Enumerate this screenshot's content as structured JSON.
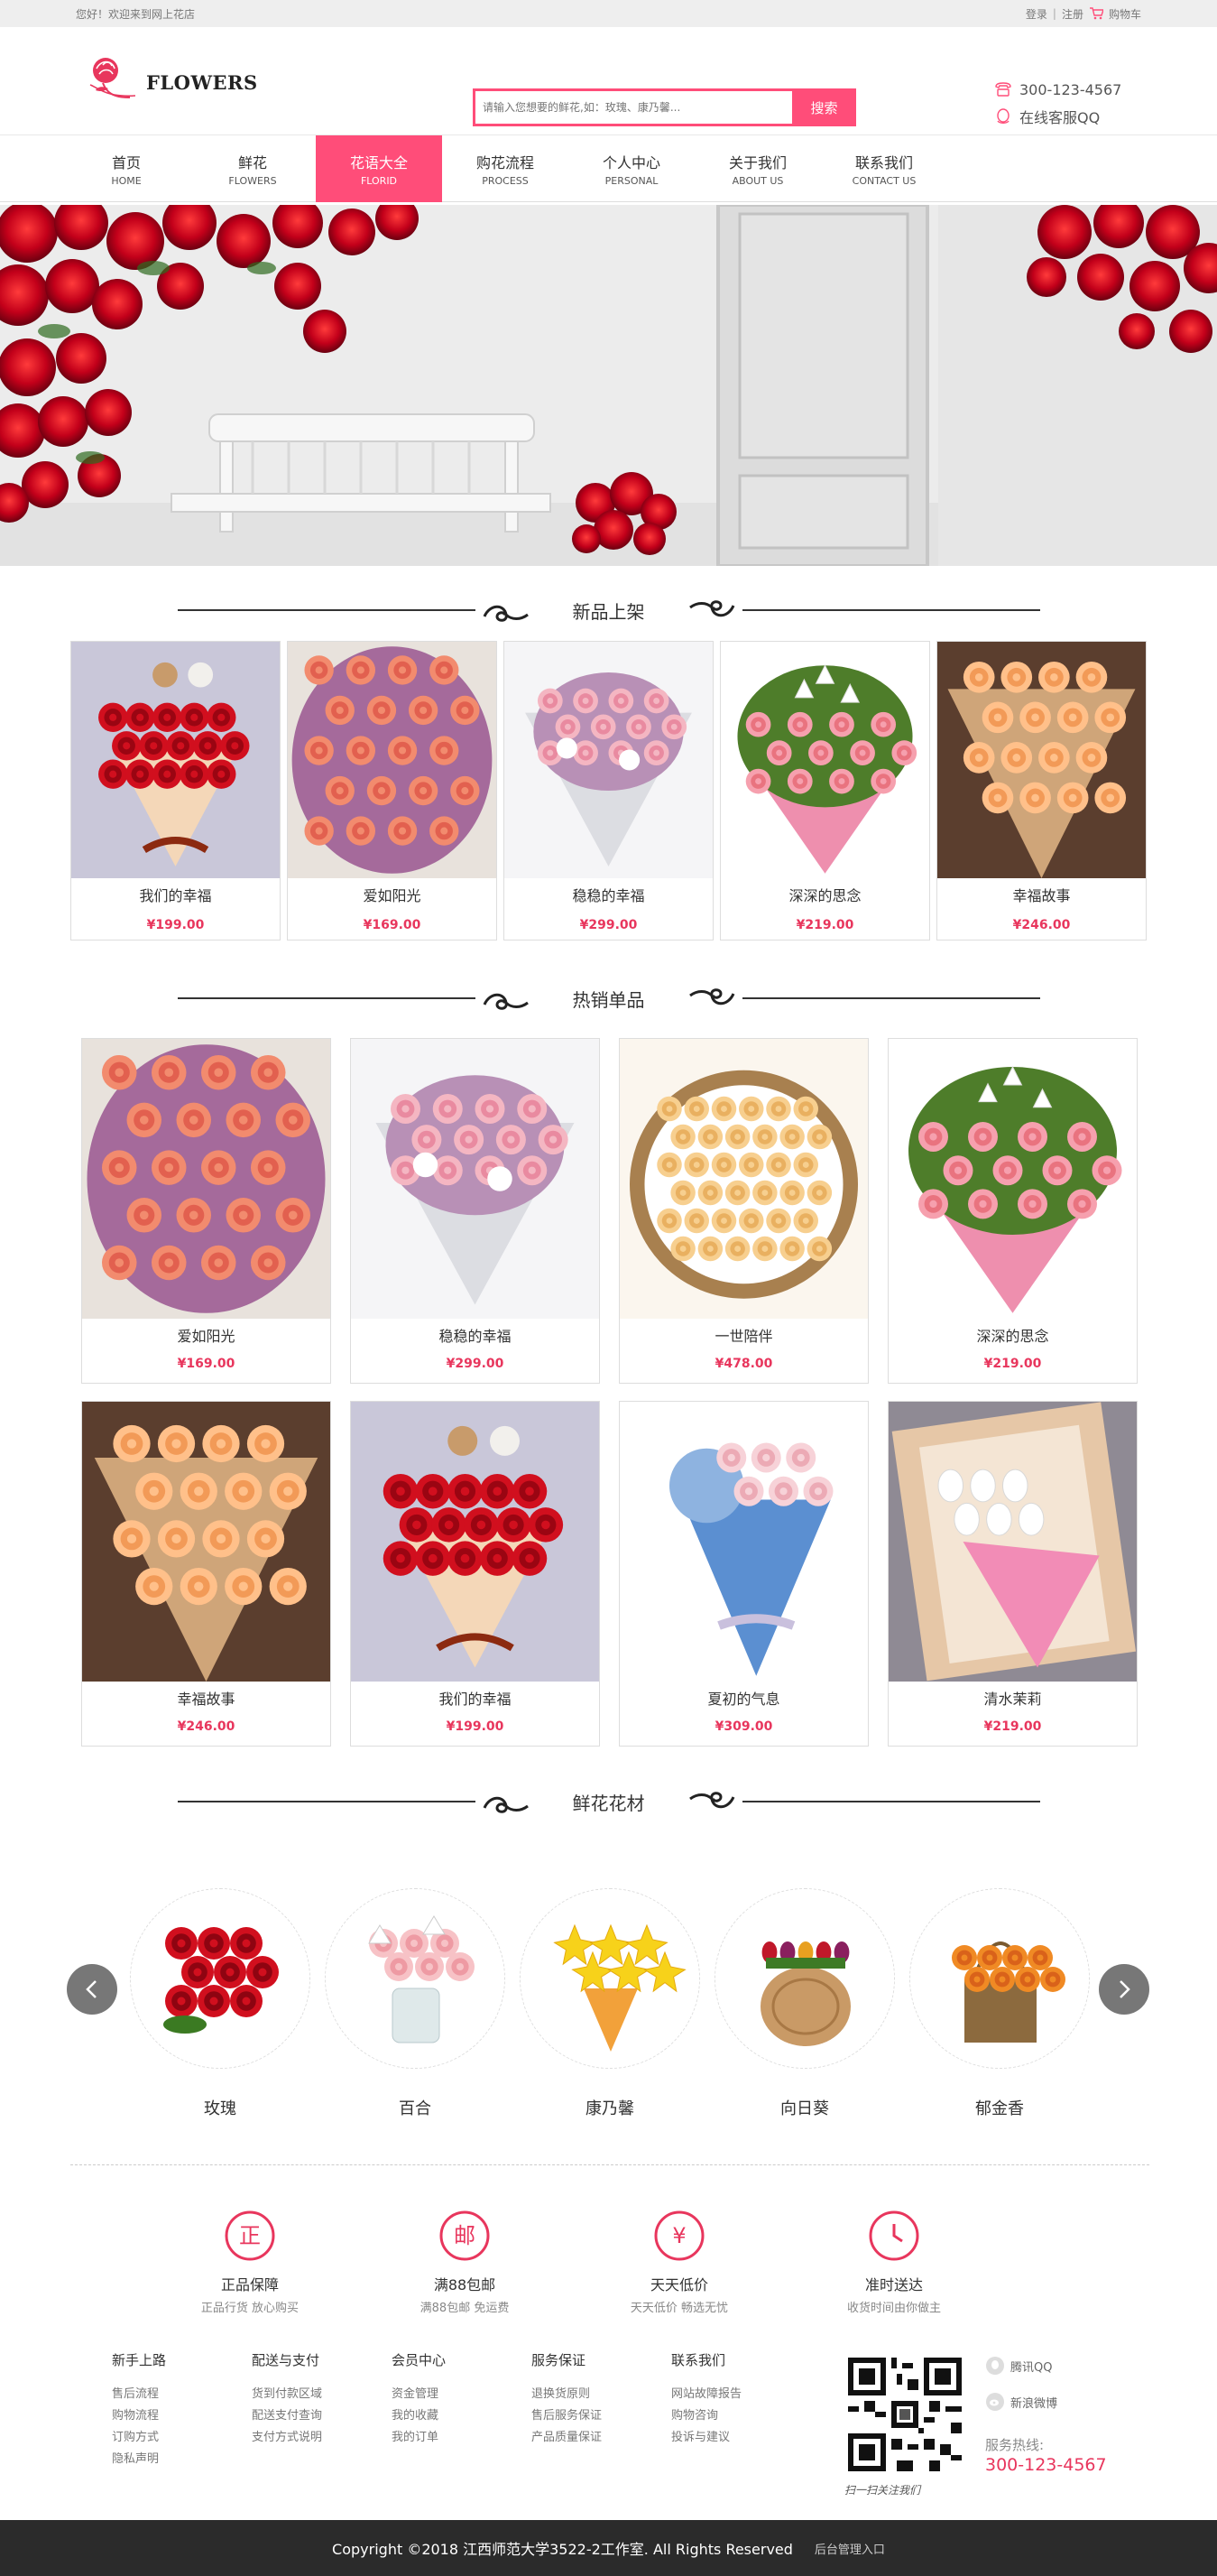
{
  "topbar": {
    "welcome": "您好！欢迎来到网上花店",
    "login": "登录",
    "sep": "|",
    "register": "注册",
    "cart": "购物车"
  },
  "header": {
    "logo_text": "FLOWERS",
    "search_placeholder": "请输入您想要的鲜花,如：玫瑰、康乃馨...",
    "search_button": "搜索",
    "phone": "300-123-4567",
    "qq": "在线客服QQ"
  },
  "nav": [
    {
      "cn": "首页",
      "en": "HOME"
    },
    {
      "cn": "鲜花",
      "en": "FLOWERS"
    },
    {
      "cn": "花语大全",
      "en": "FLORID"
    },
    {
      "cn": "购花流程",
      "en": "PROCESS"
    },
    {
      "cn": "个人中心",
      "en": "PERSONAL"
    },
    {
      "cn": "关于我们",
      "en": "ABOUT US"
    },
    {
      "cn": "联系我们",
      "en": "CONTACT US"
    }
  ],
  "active_nav": "FLORID",
  "sections": {
    "new": "新品上架",
    "hot": "热销单品",
    "material": "鲜花花材"
  },
  "new_products": [
    {
      "name": "我们的幸福",
      "price": "¥199.00",
      "art": "red-roses-bears"
    },
    {
      "name": "爱如阳光",
      "price": "¥169.00",
      "art": "pink-roses-purple"
    },
    {
      "name": "稳稳的幸福",
      "price": "¥299.00",
      "art": "pastel-white-wrap"
    },
    {
      "name": "深深的思念",
      "price": "¥219.00",
      "art": "lilies-pink"
    },
    {
      "name": "幸福故事",
      "price": "¥246.00",
      "art": "peach-roses-kraft"
    }
  ],
  "hot_products": [
    {
      "name": "爱如阳光",
      "price": "¥169.00",
      "art": "pink-roses-purple"
    },
    {
      "name": "稳稳的幸福",
      "price": "¥299.00",
      "art": "pastel-white-wrap"
    },
    {
      "name": "一世陪伴",
      "price": "¥478.00",
      "art": "champagne-roses-round"
    },
    {
      "name": "深深的思念",
      "price": "¥219.00",
      "art": "lilies-pink"
    },
    {
      "name": "幸福故事",
      "price": "¥246.00",
      "art": "peach-roses-kraft"
    },
    {
      "name": "我们的幸福",
      "price": "¥199.00",
      "art": "red-roses-bears"
    },
    {
      "name": "夏初的气息",
      "price": "¥309.00",
      "art": "blue-hydrangea"
    },
    {
      "name": "清水茉莉",
      "price": "¥219.00",
      "art": "white-tulips-box"
    }
  ],
  "materials": [
    {
      "name": "玫瑰",
      "art": "red-roses"
    },
    {
      "name": "百合",
      "art": "lily-vase"
    },
    {
      "name": "康乃馨",
      "art": "yellow-lilies"
    },
    {
      "name": "向日葵",
      "art": "tulips-wood"
    },
    {
      "name": "郁金香",
      "art": "orange-basket"
    }
  ],
  "features": [
    {
      "icon_char": "正",
      "title": "正品保障",
      "sub": "正品行货 放心购买"
    },
    {
      "icon_char": "邮",
      "title": "满88包邮",
      "sub": "满88包邮 免运费"
    },
    {
      "icon_char": "¥",
      "title": "天天低价",
      "sub": "天天低价 畅选无忧"
    },
    {
      "icon_char": "clock",
      "title": "准时送达",
      "sub": "收货时间由你做主"
    }
  ],
  "footer_cols": [
    {
      "title": "新手上路",
      "links": [
        "售后流程",
        "购物流程",
        "订购方式",
        "隐私声明"
      ]
    },
    {
      "title": "配送与支付",
      "links": [
        "货到付款区域",
        "配送支付查询",
        "支付方式说明"
      ]
    },
    {
      "title": "会员中心",
      "links": [
        "资金管理",
        "我的收藏",
        "我的订单"
      ]
    },
    {
      "title": "服务保证",
      "links": [
        "退换货原则",
        "售后服务保证",
        "产品质量保证"
      ]
    },
    {
      "title": "联系我们",
      "links": [
        "网站故障报告",
        "购物咨询",
        "投诉与建议"
      ]
    }
  ],
  "qr_caption": "扫一扫关注我们",
  "social": {
    "qq": "腾讯QQ",
    "weibo": "新浪微博"
  },
  "hotline_label": "服务热线:",
  "hotline_number": "300-123-4567",
  "footer": {
    "copyright": "Copyright ©2018  江西师范大学3522-2工作室. All Rights Reserved",
    "admin": "后台管理入口"
  },
  "colors": {
    "accent": "#ff4d79",
    "price": "#e8365d",
    "footer_bg": "#2b2b2b"
  }
}
